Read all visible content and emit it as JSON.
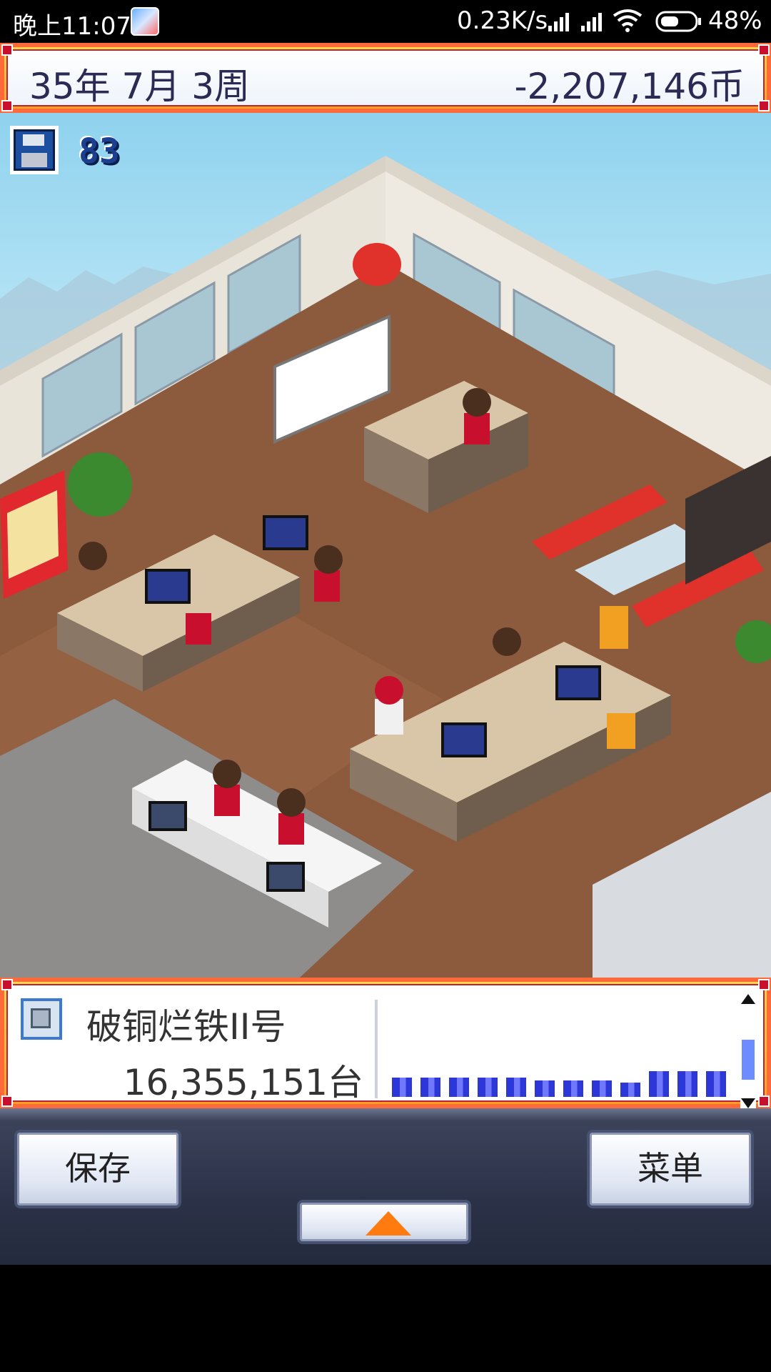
{
  "status_bar": {
    "time": "晚上11:07",
    "network_speed": "0.23K/s",
    "battery_percent": "48%",
    "icons": [
      "app-icon",
      "signal-icon",
      "signal-icon",
      "wifi-icon",
      "battery-icon"
    ]
  },
  "top_bar": {
    "date": "35年 7月 3周",
    "money": "-2,207,146币"
  },
  "save_indicator": {
    "icon": "floppy-disk-icon",
    "count": "83"
  },
  "info_panel": {
    "product_icon": "console-icon",
    "product_name": "破铜烂铁II号",
    "units_sold": "16,355,151台",
    "sales_bars": [
      0.58,
      0.58,
      0.58,
      0.58,
      0.58,
      0.5,
      0.5,
      0.5,
      0.44,
      0.78,
      0.78,
      0.78
    ]
  },
  "controls": {
    "save_label": "保存",
    "menu_label": "菜单",
    "expand_icon": "up-arrow-icon"
  },
  "colors": {
    "frame_orange": "#ff6a3a",
    "frame_gold": "#ffc035",
    "text_dark_blue": "#2b2a55",
    "bar_blue": "#2d37d7",
    "arrow_orange": "#ff7b10"
  }
}
